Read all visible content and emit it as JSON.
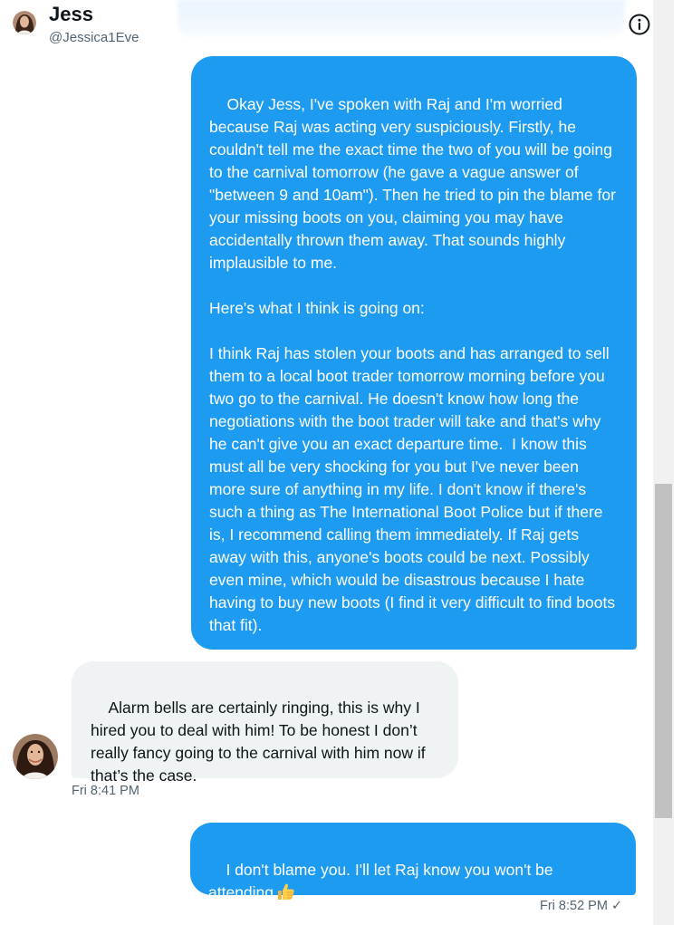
{
  "header": {
    "name": "Jess",
    "handle": "@Jessica1Eve",
    "info_icon": "info-circle-icon",
    "avatar_icon": "avatar-photo"
  },
  "messages": [
    {
      "direction": "outgoing",
      "text": "Okay Jess, I've spoken with Raj and I'm worried because Raj was acting very suspiciously. Firstly, he couldn't tell me the exact time the two of you will be going to the carnival tomorrow (he gave a vague answer of \"between 9 and 10am\"). Then he tried to pin the blame for your missing boots on you, claiming you may have accidentally thrown them away. That sounds highly implausible to me.\n\nHere's what I think is going on:\n\nI think Raj has stolen your boots and has arranged to sell them to a local boot trader tomorrow morning before you two go to the carnival. He doesn't know how long the negotiations with the boot trader will take and that's why he can't give you an exact departure time.  I know this must all be very shocking for you but I've never been more sure of anything in my life. I don't know if there's such a thing as The International Boot Police but if there is, I recommend calling them immediately. If Raj gets away with this, anyone's boots could be next. Possibly even mine, which would be disastrous because I hate having to buy new boots (I find it very difficult to find boots that fit)."
    },
    {
      "direction": "incoming",
      "text": "Alarm bells are certainly ringing, this is why I hired you to deal with him! To be honest I don’t really fancy going to the carnival with him now if that’s the case.",
      "timestamp": "Fri 8:41 PM"
    },
    {
      "direction": "outgoing",
      "text": "I don't blame you. I'll let Raj know you won't be attending",
      "emoji": "thumbs-up-icon",
      "timestamp": "Fri 8:52 PM",
      "status": "✓"
    }
  ],
  "colors": {
    "outgoing_bubble": "#1d9bf0",
    "incoming_bubble": "#eff3f4",
    "muted_text": "#536471",
    "primary_text": "#0f1419"
  }
}
